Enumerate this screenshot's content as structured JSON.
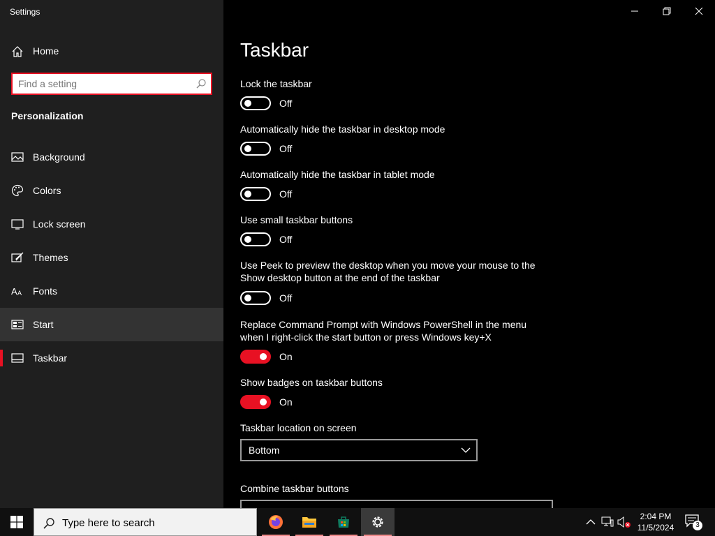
{
  "app": {
    "title": "Settings"
  },
  "sidebar": {
    "home_label": "Home",
    "search_placeholder": "Find a setting",
    "section_title": "Personalization",
    "items": [
      {
        "label": "Background",
        "icon": "image-icon"
      },
      {
        "label": "Colors",
        "icon": "palette-icon"
      },
      {
        "label": "Lock screen",
        "icon": "monitor-icon"
      },
      {
        "label": "Themes",
        "icon": "brush-icon"
      },
      {
        "label": "Fonts",
        "icon": "font-icon"
      },
      {
        "label": "Start",
        "icon": "start-grid-icon",
        "hovered": true
      },
      {
        "label": "Taskbar",
        "icon": "taskbar-icon",
        "selected": true
      }
    ]
  },
  "main": {
    "title": "Taskbar",
    "settings": [
      {
        "label": "Lock the taskbar",
        "state": "Off"
      },
      {
        "label": "Automatically hide the taskbar in desktop mode",
        "state": "Off"
      },
      {
        "label": "Automatically hide the taskbar in tablet mode",
        "state": "Off"
      },
      {
        "label": "Use small taskbar buttons",
        "state": "Off"
      },
      {
        "label": "Use Peek to preview the desktop when you move your mouse to the Show desktop button at the end of the taskbar",
        "state": "Off"
      },
      {
        "label": "Replace Command Prompt with Windows PowerShell in the menu when I right-click the start button or press Windows key+X",
        "state": "On"
      },
      {
        "label": "Show badges on taskbar buttons",
        "state": "On"
      }
    ],
    "location": {
      "label": "Taskbar location on screen",
      "value": "Bottom"
    },
    "combine": {
      "label": "Combine taskbar buttons"
    }
  },
  "taskbar": {
    "search_text": "Type here to search",
    "apps": [
      "firefox-icon",
      "file-explorer-icon",
      "store-icon",
      "settings-gear-icon"
    ],
    "clock": {
      "time": "2:04 PM",
      "date": "11/5/2024"
    },
    "notification_count": "3"
  },
  "colors": {
    "accent": "#e81123",
    "sidebar_bg": "#1f1f1f",
    "main_bg": "#000000"
  }
}
